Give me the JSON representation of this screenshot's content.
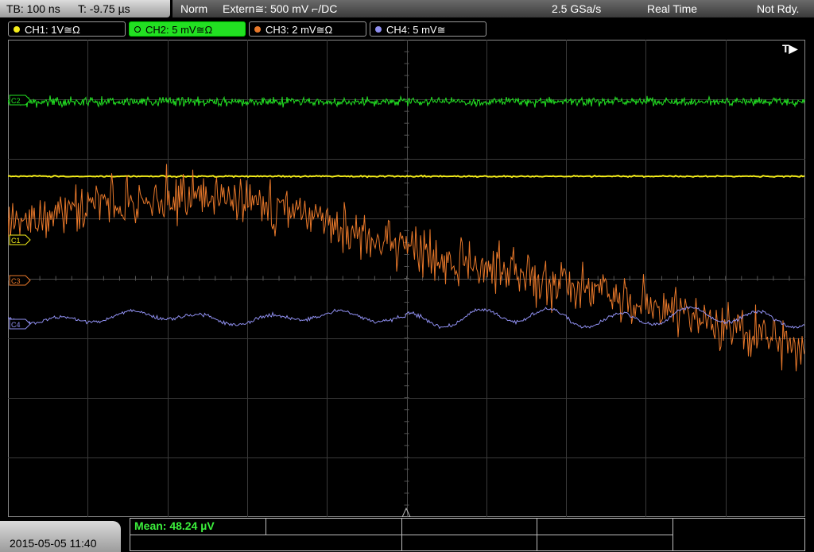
{
  "header": {
    "timebase": "TB: 100 ns",
    "trigger_time": "T: -9.75 µs",
    "mode": "Norm",
    "trigger_source": "Extern≅: 500 mV ⌐/DC",
    "sample_rate": "2.5 GSa/s",
    "acquisition": "Real Time",
    "status": "Not Rdy."
  },
  "channels": [
    {
      "label": "CH1: 1V≅Ω",
      "color": "#f5ee1a",
      "marker": "C1"
    },
    {
      "label": "CH2: 5 mV≅Ω",
      "color": "#22e022",
      "marker": "C2",
      "active": true
    },
    {
      "label": "CH3: 2 mV≅Ω",
      "color": "#e8782a",
      "marker": "C3"
    },
    {
      "label": "CH4: 5 mV≅",
      "color": "#8f8ff0",
      "marker": "C4"
    }
  ],
  "display": {
    "trigger_marker": "T▶"
  },
  "footer": {
    "datetime": "2015-05-05 11:40",
    "measurement": "Mean: 48.24 µV"
  }
}
